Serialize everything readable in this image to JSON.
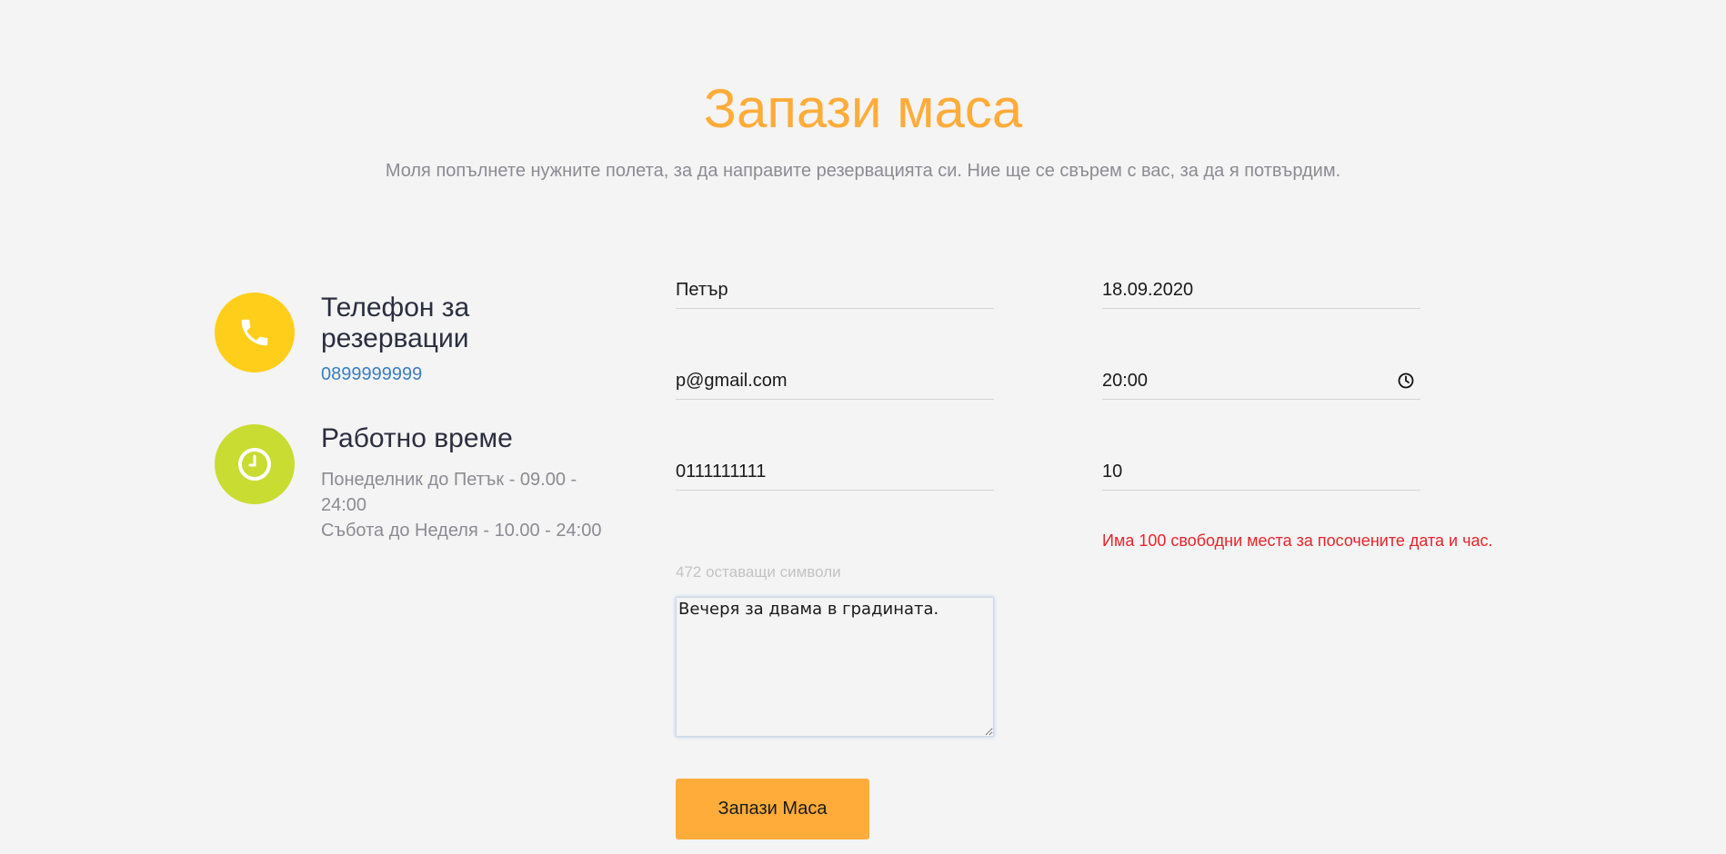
{
  "header": {
    "title": "Запази маса",
    "subtitle": "Моля попълнете нужните полета, за да направите резервацията си. Ние ще се свърем с вас, за да я потвърдим."
  },
  "info": {
    "phone_heading": "Телефон за резервации",
    "phone_number": "0899999999",
    "hours_heading": "Работно време",
    "hours_weekdays": "Понеделник до Петък - 09.00 - 24:00",
    "hours_weekend": "Събота до Неделя - 10.00 - 24:00",
    "phone_icon_color": "#ffce1a",
    "clock_icon_color": "#c8dc32"
  },
  "form": {
    "name_value": "Петър",
    "email_value": "p@gmail.com",
    "phone_value": "0111111111",
    "date_value": "18.09.2020",
    "time_value": "20:00",
    "guests_value": "10",
    "availability_message": "Има 100 свободни места за посочените дата и час.",
    "chars_remaining": "472 оставащи символи",
    "message_value": "Вечеря за двама в градината.",
    "submit_label": "Запази Маса"
  },
  "colors": {
    "accent": "#ffac3a",
    "error": "#e8242a",
    "link": "#3b7dbf"
  }
}
